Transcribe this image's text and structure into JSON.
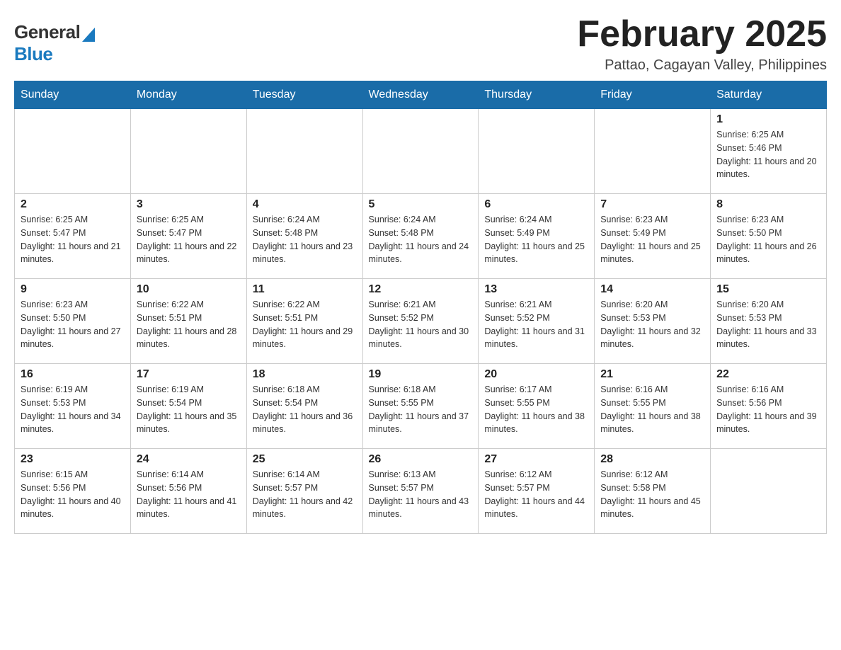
{
  "header": {
    "title": "February 2025",
    "subtitle": "Pattao, Cagayan Valley, Philippines"
  },
  "logo": {
    "line1": "General",
    "line2": "Blue"
  },
  "days_of_week": [
    "Sunday",
    "Monday",
    "Tuesday",
    "Wednesday",
    "Thursday",
    "Friday",
    "Saturday"
  ],
  "weeks": [
    [
      {
        "day": "",
        "sunrise": "",
        "sunset": "",
        "daylight": ""
      },
      {
        "day": "",
        "sunrise": "",
        "sunset": "",
        "daylight": ""
      },
      {
        "day": "",
        "sunrise": "",
        "sunset": "",
        "daylight": ""
      },
      {
        "day": "",
        "sunrise": "",
        "sunset": "",
        "daylight": ""
      },
      {
        "day": "",
        "sunrise": "",
        "sunset": "",
        "daylight": ""
      },
      {
        "day": "",
        "sunrise": "",
        "sunset": "",
        "daylight": ""
      },
      {
        "day": "1",
        "sunrise": "Sunrise: 6:25 AM",
        "sunset": "Sunset: 5:46 PM",
        "daylight": "Daylight: 11 hours and 20 minutes."
      }
    ],
    [
      {
        "day": "2",
        "sunrise": "Sunrise: 6:25 AM",
        "sunset": "Sunset: 5:47 PM",
        "daylight": "Daylight: 11 hours and 21 minutes."
      },
      {
        "day": "3",
        "sunrise": "Sunrise: 6:25 AM",
        "sunset": "Sunset: 5:47 PM",
        "daylight": "Daylight: 11 hours and 22 minutes."
      },
      {
        "day": "4",
        "sunrise": "Sunrise: 6:24 AM",
        "sunset": "Sunset: 5:48 PM",
        "daylight": "Daylight: 11 hours and 23 minutes."
      },
      {
        "day": "5",
        "sunrise": "Sunrise: 6:24 AM",
        "sunset": "Sunset: 5:48 PM",
        "daylight": "Daylight: 11 hours and 24 minutes."
      },
      {
        "day": "6",
        "sunrise": "Sunrise: 6:24 AM",
        "sunset": "Sunset: 5:49 PM",
        "daylight": "Daylight: 11 hours and 25 minutes."
      },
      {
        "day": "7",
        "sunrise": "Sunrise: 6:23 AM",
        "sunset": "Sunset: 5:49 PM",
        "daylight": "Daylight: 11 hours and 25 minutes."
      },
      {
        "day": "8",
        "sunrise": "Sunrise: 6:23 AM",
        "sunset": "Sunset: 5:50 PM",
        "daylight": "Daylight: 11 hours and 26 minutes."
      }
    ],
    [
      {
        "day": "9",
        "sunrise": "Sunrise: 6:23 AM",
        "sunset": "Sunset: 5:50 PM",
        "daylight": "Daylight: 11 hours and 27 minutes."
      },
      {
        "day": "10",
        "sunrise": "Sunrise: 6:22 AM",
        "sunset": "Sunset: 5:51 PM",
        "daylight": "Daylight: 11 hours and 28 minutes."
      },
      {
        "day": "11",
        "sunrise": "Sunrise: 6:22 AM",
        "sunset": "Sunset: 5:51 PM",
        "daylight": "Daylight: 11 hours and 29 minutes."
      },
      {
        "day": "12",
        "sunrise": "Sunrise: 6:21 AM",
        "sunset": "Sunset: 5:52 PM",
        "daylight": "Daylight: 11 hours and 30 minutes."
      },
      {
        "day": "13",
        "sunrise": "Sunrise: 6:21 AM",
        "sunset": "Sunset: 5:52 PM",
        "daylight": "Daylight: 11 hours and 31 minutes."
      },
      {
        "day": "14",
        "sunrise": "Sunrise: 6:20 AM",
        "sunset": "Sunset: 5:53 PM",
        "daylight": "Daylight: 11 hours and 32 minutes."
      },
      {
        "day": "15",
        "sunrise": "Sunrise: 6:20 AM",
        "sunset": "Sunset: 5:53 PM",
        "daylight": "Daylight: 11 hours and 33 minutes."
      }
    ],
    [
      {
        "day": "16",
        "sunrise": "Sunrise: 6:19 AM",
        "sunset": "Sunset: 5:53 PM",
        "daylight": "Daylight: 11 hours and 34 minutes."
      },
      {
        "day": "17",
        "sunrise": "Sunrise: 6:19 AM",
        "sunset": "Sunset: 5:54 PM",
        "daylight": "Daylight: 11 hours and 35 minutes."
      },
      {
        "day": "18",
        "sunrise": "Sunrise: 6:18 AM",
        "sunset": "Sunset: 5:54 PM",
        "daylight": "Daylight: 11 hours and 36 minutes."
      },
      {
        "day": "19",
        "sunrise": "Sunrise: 6:18 AM",
        "sunset": "Sunset: 5:55 PM",
        "daylight": "Daylight: 11 hours and 37 minutes."
      },
      {
        "day": "20",
        "sunrise": "Sunrise: 6:17 AM",
        "sunset": "Sunset: 5:55 PM",
        "daylight": "Daylight: 11 hours and 38 minutes."
      },
      {
        "day": "21",
        "sunrise": "Sunrise: 6:16 AM",
        "sunset": "Sunset: 5:55 PM",
        "daylight": "Daylight: 11 hours and 38 minutes."
      },
      {
        "day": "22",
        "sunrise": "Sunrise: 6:16 AM",
        "sunset": "Sunset: 5:56 PM",
        "daylight": "Daylight: 11 hours and 39 minutes."
      }
    ],
    [
      {
        "day": "23",
        "sunrise": "Sunrise: 6:15 AM",
        "sunset": "Sunset: 5:56 PM",
        "daylight": "Daylight: 11 hours and 40 minutes."
      },
      {
        "day": "24",
        "sunrise": "Sunrise: 6:14 AM",
        "sunset": "Sunset: 5:56 PM",
        "daylight": "Daylight: 11 hours and 41 minutes."
      },
      {
        "day": "25",
        "sunrise": "Sunrise: 6:14 AM",
        "sunset": "Sunset: 5:57 PM",
        "daylight": "Daylight: 11 hours and 42 minutes."
      },
      {
        "day": "26",
        "sunrise": "Sunrise: 6:13 AM",
        "sunset": "Sunset: 5:57 PM",
        "daylight": "Daylight: 11 hours and 43 minutes."
      },
      {
        "day": "27",
        "sunrise": "Sunrise: 6:12 AM",
        "sunset": "Sunset: 5:57 PM",
        "daylight": "Daylight: 11 hours and 44 minutes."
      },
      {
        "day": "28",
        "sunrise": "Sunrise: 6:12 AM",
        "sunset": "Sunset: 5:58 PM",
        "daylight": "Daylight: 11 hours and 45 minutes."
      },
      {
        "day": "",
        "sunrise": "",
        "sunset": "",
        "daylight": ""
      }
    ]
  ]
}
